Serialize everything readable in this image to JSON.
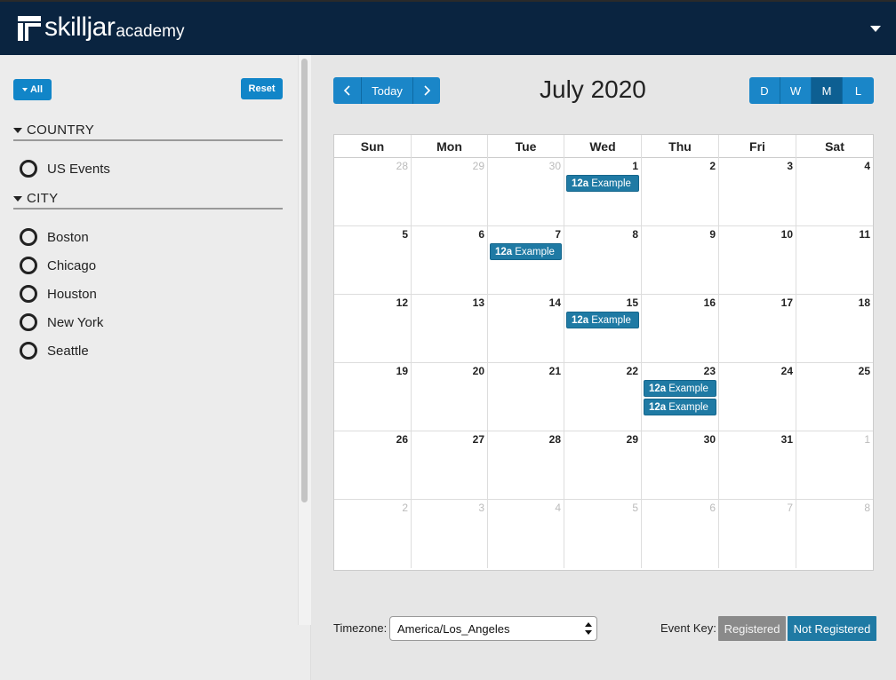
{
  "header": {
    "logo_main": "skilljar",
    "logo_sub": "academy",
    "menu_icon": "caret-down-icon"
  },
  "sidebar": {
    "all_button_label": "All",
    "reset_button_label": "Reset",
    "sections": [
      {
        "title": "COUNTRY",
        "options": [
          "US Events"
        ]
      },
      {
        "title": "CITY",
        "options": [
          "Boston",
          "Chicago",
          "Houston",
          "New York",
          "Seattle"
        ]
      }
    ]
  },
  "calendar": {
    "title": "July 2020",
    "nav": {
      "prev_icon": "chevron-left-icon",
      "today_label": "Today",
      "next_icon": "chevron-right-icon"
    },
    "views": [
      {
        "label": "D",
        "active": false
      },
      {
        "label": "W",
        "active": false
      },
      {
        "label": "M",
        "active": true
      },
      {
        "label": "L",
        "active": false
      }
    ],
    "day_names": [
      "Sun",
      "Mon",
      "Tue",
      "Wed",
      "Thu",
      "Fri",
      "Sat"
    ],
    "weeks": [
      [
        {
          "num": "28",
          "other": true,
          "events": []
        },
        {
          "num": "29",
          "other": true,
          "events": []
        },
        {
          "num": "30",
          "other": true,
          "events": []
        },
        {
          "num": "1",
          "other": false,
          "events": [
            {
              "time": "12a",
              "title": "Example"
            }
          ]
        },
        {
          "num": "2",
          "other": false,
          "events": []
        },
        {
          "num": "3",
          "other": false,
          "events": []
        },
        {
          "num": "4",
          "other": false,
          "events": []
        }
      ],
      [
        {
          "num": "5",
          "other": false,
          "events": []
        },
        {
          "num": "6",
          "other": false,
          "events": []
        },
        {
          "num": "7",
          "other": false,
          "events": [
            {
              "time": "12a",
              "title": "Example"
            }
          ]
        },
        {
          "num": "8",
          "other": false,
          "events": []
        },
        {
          "num": "9",
          "other": false,
          "events": []
        },
        {
          "num": "10",
          "other": false,
          "events": []
        },
        {
          "num": "11",
          "other": false,
          "events": []
        }
      ],
      [
        {
          "num": "12",
          "other": false,
          "events": []
        },
        {
          "num": "13",
          "other": false,
          "events": []
        },
        {
          "num": "14",
          "other": false,
          "events": []
        },
        {
          "num": "15",
          "other": false,
          "events": [
            {
              "time": "12a",
              "title": "Example"
            }
          ]
        },
        {
          "num": "16",
          "other": false,
          "events": []
        },
        {
          "num": "17",
          "other": false,
          "events": []
        },
        {
          "num": "18",
          "other": false,
          "events": []
        }
      ],
      [
        {
          "num": "19",
          "other": false,
          "events": []
        },
        {
          "num": "20",
          "other": false,
          "events": []
        },
        {
          "num": "21",
          "other": false,
          "events": []
        },
        {
          "num": "22",
          "other": false,
          "events": []
        },
        {
          "num": "23",
          "other": false,
          "events": [
            {
              "time": "12a",
              "title": "Example"
            },
            {
              "time": "12a",
              "title": "Example"
            }
          ]
        },
        {
          "num": "24",
          "other": false,
          "events": []
        },
        {
          "num": "25",
          "other": false,
          "events": []
        }
      ],
      [
        {
          "num": "26",
          "other": false,
          "events": []
        },
        {
          "num": "27",
          "other": false,
          "events": []
        },
        {
          "num": "28",
          "other": false,
          "events": []
        },
        {
          "num": "29",
          "other": false,
          "events": []
        },
        {
          "num": "30",
          "other": false,
          "events": []
        },
        {
          "num": "31",
          "other": false,
          "events": []
        },
        {
          "num": "1",
          "other": true,
          "events": []
        }
      ],
      [
        {
          "num": "2",
          "other": true,
          "events": []
        },
        {
          "num": "3",
          "other": true,
          "events": []
        },
        {
          "num": "4",
          "other": true,
          "events": []
        },
        {
          "num": "5",
          "other": true,
          "events": []
        },
        {
          "num": "6",
          "other": true,
          "events": []
        },
        {
          "num": "7",
          "other": true,
          "events": []
        },
        {
          "num": "8",
          "other": true,
          "events": []
        }
      ]
    ]
  },
  "footer": {
    "timezone_label": "Timezone:",
    "timezone_value": "America/Los_Angeles",
    "event_key_label": "Event Key:",
    "registered_label": "Registered",
    "not_registered_label": "Not Registered"
  },
  "colors": {
    "header_bg": "#0a2440",
    "accent_blue": "#1a86c8",
    "event_blue": "#1f7aa4",
    "registered_gray": "#8a8a8a"
  }
}
